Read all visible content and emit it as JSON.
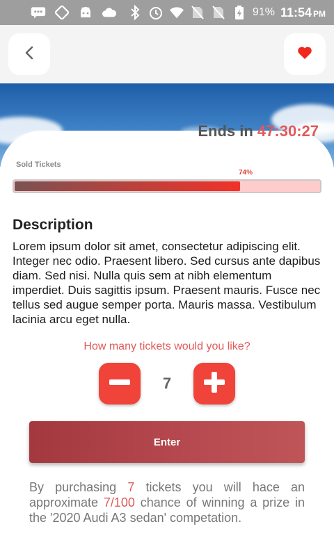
{
  "status_bar": {
    "battery": "91%",
    "time": "11:54",
    "ampm": "PM",
    "icons": [
      "chat-icon",
      "rotate-icon",
      "android-icon",
      "cloud-icon",
      "bluetooth-icon",
      "alarm-icon",
      "wifi-icon",
      "no-sim-icon",
      "no-sim-icon",
      "battery-charging-icon"
    ]
  },
  "header": {
    "back_icon": "chevron-left-icon",
    "favorite_icon": "heart-icon",
    "favorite_color": "#f0271e"
  },
  "hero": {
    "ends_label": "Ends in",
    "countdown": "47:30:27"
  },
  "sold": {
    "label": "Sold Tickets",
    "percent_text": "74%",
    "fraction": 0.74
  },
  "description": {
    "title": "Description",
    "text": "Lorem ipsum dolor sit amet, consectetur adipiscing elit. Integer nec odio. Praesent libero. Sed cursus ante dapibus diam. Sed nisi. Nulla quis sem at nibh elementum imperdiet. Duis sagittis ipsum. Praesent mauris. Fusce nec tellus sed augue semper porta. Mauris massa. Vestibulum lacinia arcu eget nulla."
  },
  "tickets": {
    "question": "How many tickets would you like?",
    "quantity": "7",
    "decrement_icon": "minus-icon",
    "increment_icon": "plus-icon"
  },
  "enter_button": "Enter",
  "purchase_info": {
    "part1": "By purchasing ",
    "count": "7",
    "part2": " tickets you will hace an approximate ",
    "chance": "7/100",
    "part3": " chance of winning a prize in the '2020 Audi A3 sedan' competation."
  },
  "colors": {
    "accent": "#f0433a",
    "highlight": "#e05a5a",
    "enter_button": "#b3454b"
  }
}
